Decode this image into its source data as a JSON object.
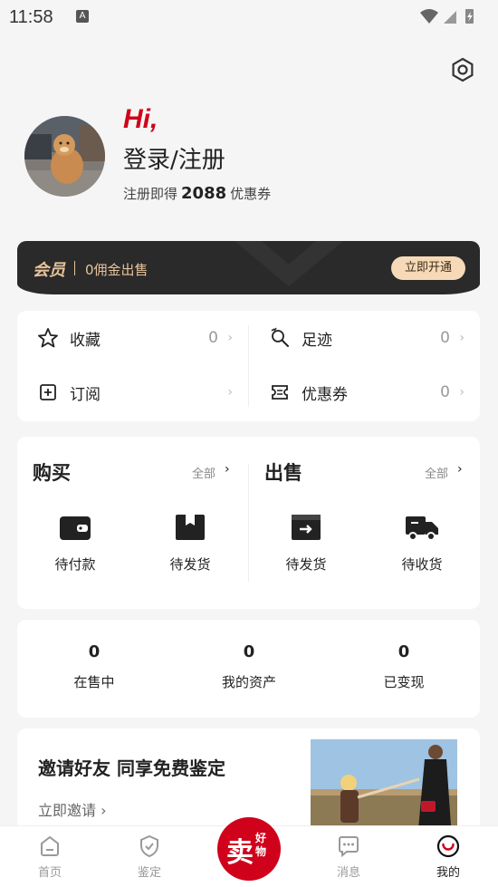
{
  "status_bar": {
    "time": "11:58",
    "notif_letter": "A"
  },
  "profile": {
    "greeting": "Hi,",
    "login_label": "登录/注册",
    "sub_prefix": "注册即得",
    "sub_amount": "2088",
    "sub_suffix": "优惠券"
  },
  "vip": {
    "title": "会员",
    "desc": "0佣金出售",
    "button": "立即开通"
  },
  "quick": [
    {
      "label": "收藏",
      "count": "0",
      "icon": "star-icon"
    },
    {
      "label": "足迹",
      "count": "0",
      "icon": "footprint-icon"
    },
    {
      "label": "订阅",
      "count": "",
      "icon": "plus-square-icon"
    },
    {
      "label": "优惠券",
      "count": "0",
      "icon": "coupon-icon"
    }
  ],
  "buy": {
    "title": "购买",
    "all": "全部",
    "items": [
      {
        "label": "待付款",
        "icon": "wallet-icon"
      },
      {
        "label": "待发货",
        "icon": "box-icon"
      }
    ]
  },
  "sell": {
    "title": "出售",
    "all": "全部",
    "items": [
      {
        "label": "待发货",
        "icon": "ship-box-icon"
      },
      {
        "label": "待收货",
        "icon": "truck-icon"
      }
    ]
  },
  "stats": [
    {
      "value": "0",
      "label": "在售中"
    },
    {
      "value": "0",
      "label": "我的资产"
    },
    {
      "value": "0",
      "label": "已变现"
    }
  ],
  "invite": {
    "title": "邀请好友 同享免费鉴定",
    "link": "立即邀请"
  },
  "tabbar": {
    "tabs": [
      {
        "label": "首页",
        "icon": "home-icon"
      },
      {
        "label": "鉴定",
        "icon": "shield-check-icon"
      },
      {
        "label": "消息",
        "icon": "chat-icon"
      },
      {
        "label": "我的",
        "icon": "profile-smile-icon"
      }
    ],
    "sell_big": "卖",
    "sell_small": "好物",
    "active_tab": "我的"
  },
  "colors": {
    "brand_red": "#d0021b",
    "vip_gold": "#e7c29a",
    "vip_bg": "#2a2a2a"
  }
}
